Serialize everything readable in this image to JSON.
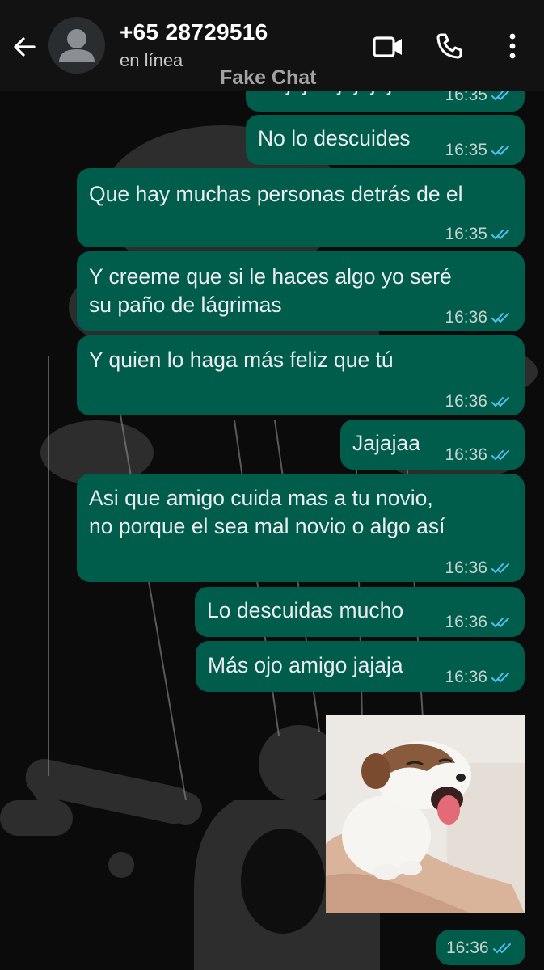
{
  "header": {
    "contact_name": "+65 28729516",
    "status": "en línea",
    "watermark": "Fake Chat"
  },
  "icons": {
    "back": "arrow-left-icon",
    "avatar": "default-person-avatar",
    "video": "video-camera-icon",
    "call": "phone-icon",
    "menu": "vertical-dots-icon",
    "read_receipt": "double-check-icon"
  },
  "colors": {
    "header_bg": "#121212",
    "bubble_outgoing": "#005c4b",
    "read_tick": "#53bdeb",
    "message_text": "#e9edef"
  },
  "messages": [
    {
      "direction": "outgoing",
      "text": "Jajajaa jajajaja",
      "time": "16:35",
      "status": "read"
    },
    {
      "direction": "outgoing",
      "text": "No lo descuides",
      "time": "16:35",
      "status": "read"
    },
    {
      "direction": "outgoing",
      "text": "Que hay muchas personas detrás de el",
      "time": "16:35",
      "status": "read"
    },
    {
      "direction": "outgoing",
      "lines": [
        "Y creeme que si le haces algo yo seré",
        "su paño de lágrimas"
      ],
      "time": "16:36",
      "status": "read"
    },
    {
      "direction": "outgoing",
      "text": "Y quien lo haga más feliz que tú",
      "time": "16:36",
      "status": "read"
    },
    {
      "direction": "outgoing",
      "text": "Jajajaa",
      "time": "16:36",
      "status": "read"
    },
    {
      "direction": "outgoing",
      "lines": [
        "Asi que amigo cuida mas a tu novio,",
        "no porque el sea mal novio o algo así"
      ],
      "time": "16:36",
      "status": "read"
    },
    {
      "direction": "outgoing",
      "text": "Lo descuidas mucho",
      "time": "16:36",
      "status": "read"
    },
    {
      "direction": "outgoing",
      "text": "Más ojo amigo jajaja",
      "time": "16:36",
      "status": "read"
    },
    {
      "direction": "outgoing",
      "type": "image",
      "image_subject": "laughing-puppy-sticker",
      "time": "16:36",
      "status": "read"
    }
  ]
}
